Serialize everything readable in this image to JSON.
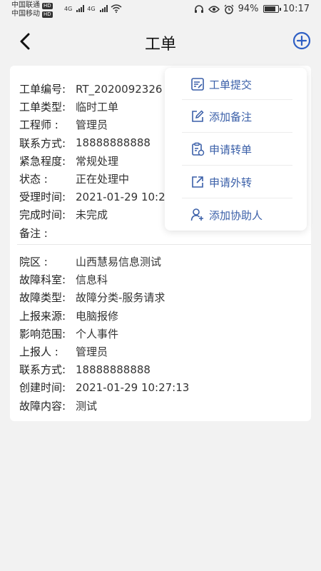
{
  "status_bar": {
    "carrier1": "中国联通",
    "carrier2": "中国移动",
    "hd": "HD",
    "net": "4G",
    "battery": "94%",
    "time": "10:17"
  },
  "header": {
    "title": "工单"
  },
  "colors": {
    "accent": "#2f5fc4",
    "menu_text": "#3a5fa8"
  },
  "order": {
    "rows": [
      {
        "label": "工单编号:",
        "value": "RT_2020092326"
      },
      {
        "label": "工单类型:",
        "value": "临时工单"
      },
      {
        "label": "工程师  :",
        "value": "管理员"
      },
      {
        "label": "联系方式:",
        "value": "18888888888"
      },
      {
        "label": "紧急程度:",
        "value": "常规处理"
      },
      {
        "label": "状态    :",
        "value": "正在处理中"
      },
      {
        "label": "受理时间:",
        "value": "2021-01-29 10:2"
      },
      {
        "label": "完成时间:",
        "value": "未完成"
      },
      {
        "label": "备注    :",
        "value": ""
      }
    ]
  },
  "fault": {
    "rows": [
      {
        "label": "院区    :",
        "value": "山西慧易信息测试"
      },
      {
        "label": "故障科室:",
        "value": "信息科"
      },
      {
        "label": "故障类型:",
        "value": "故障分类-服务请求"
      },
      {
        "label": "上报来源:",
        "value": "电脑报修"
      },
      {
        "label": "影响范围:",
        "value": "个人事件"
      },
      {
        "label": "上报人  :",
        "value": "管理员"
      },
      {
        "label": "联系方式:",
        "value": "18888888888"
      },
      {
        "label": "创建时间:",
        "value": "2021-01-29 10:27:13"
      },
      {
        "label": "故障内容:",
        "value": "测试"
      }
    ]
  },
  "menu": {
    "items": [
      {
        "label": "工单提交",
        "icon": "submit-icon"
      },
      {
        "label": "添加备注",
        "icon": "edit-note-icon"
      },
      {
        "label": "申请转单",
        "icon": "transfer-icon"
      },
      {
        "label": "申请外转",
        "icon": "external-icon"
      },
      {
        "label": "添加协助人",
        "icon": "add-helper-icon"
      }
    ]
  }
}
